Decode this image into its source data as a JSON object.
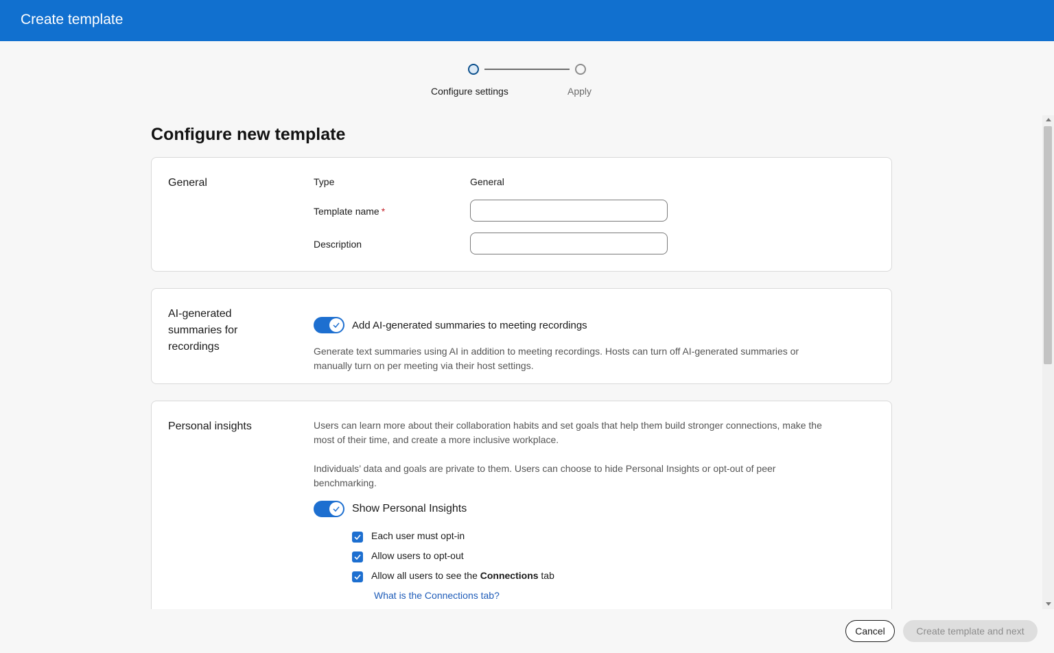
{
  "header": {
    "title": "Create template"
  },
  "stepper": {
    "steps": [
      {
        "label": "Configure settings",
        "state": "active"
      },
      {
        "label": "Apply",
        "state": "inactive"
      }
    ]
  },
  "page": {
    "heading": "Configure new template"
  },
  "general": {
    "section_title": "General",
    "type_label": "Type",
    "type_value": "General",
    "template_name_label": "Template name",
    "required_marker": "*",
    "template_name_value": "",
    "description_label": "Description",
    "description_value": ""
  },
  "ai_summaries": {
    "section_title_line1": "AI-generated",
    "section_title_line2": "summaries for",
    "section_title_line3": "recordings",
    "toggle_on": true,
    "toggle_label": "Add AI-generated summaries to meeting recordings",
    "description_line1": "Generate text summaries using AI in addition to meeting recordings. Hosts can turn off AI-generated summaries or",
    "description_line2": "manually turn on per meeting via their host settings."
  },
  "personal_insights": {
    "section_title": "Personal insights",
    "paragraph1_line1": "Users can learn more about their collaboration habits and set goals that help them build stronger connections, make the",
    "paragraph1_line2": "most of their time, and create a more inclusive workplace.",
    "paragraph2_line1": "Individuals’ data and goals are private to them. Users can choose to hide Personal Insights or opt-out of peer",
    "paragraph2_line2": "benchmarking.",
    "toggle_on": true,
    "toggle_label": "Show Personal Insights",
    "checkboxes": [
      {
        "label": "Each user must opt-in",
        "checked": true
      },
      {
        "label": "Allow users to opt-out",
        "checked": true
      },
      {
        "label_prefix": "Allow all users to see the ",
        "label_bold": "Connections",
        "label_suffix": " tab",
        "checked": true
      }
    ],
    "help_link": "What is the Connections tab?"
  },
  "footer": {
    "cancel_label": "Cancel",
    "next_label": "Create template and next"
  },
  "colors": {
    "header_bg": "#1170cf",
    "accent": "#1d6fd0",
    "link": "#1d5bb8",
    "required": "#c4232b",
    "disabled_button_bg": "#dedede"
  }
}
